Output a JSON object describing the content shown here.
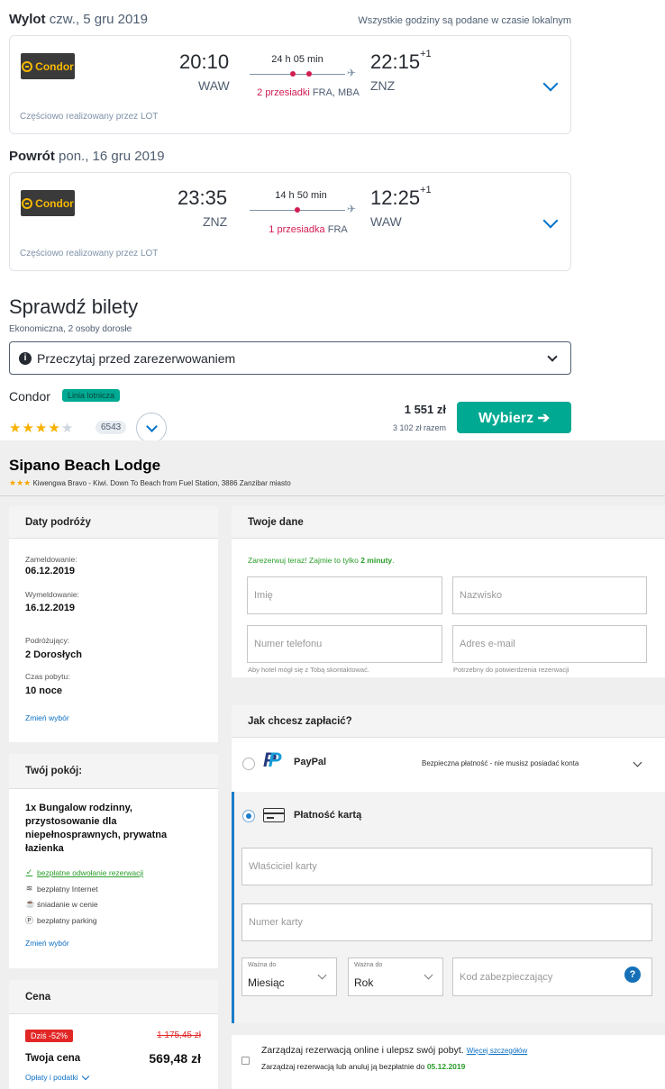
{
  "flights": {
    "timezone_note": "Wszystkie godziny są podane w czasie lokalnym",
    "outbound": {
      "label": "Wylot",
      "date": "czw., 5 gru 2019",
      "carrier": "Condor",
      "dep_time": "20:10",
      "dep_code": "WAW",
      "arr_time": "22:15",
      "arr_day_offset": "+1",
      "arr_code": "ZNZ",
      "duration": "24 h 05 min",
      "stops_label": "2 przesiadki",
      "stops_airports": "FRA, MBA",
      "operated_by": "Częściowo realizowany przez LOT"
    },
    "return": {
      "label": "Powrót",
      "date": "pon., 16 gru 2019",
      "carrier": "Condor",
      "dep_time": "23:35",
      "dep_code": "ZNZ",
      "arr_time": "12:25",
      "arr_day_offset": "+1",
      "arr_code": "WAW",
      "duration": "14 h 50 min",
      "stops_label": "1 przesiadka",
      "stops_airports": "FRA",
      "operated_by": "Częściowo realizowany przez LOT"
    }
  },
  "tickets": {
    "title": "Sprawdź bilety",
    "subtitle": "Ekonomiczna, 2 osoby dorosłe",
    "read_before": "Przeczytaj przed zarezerwowaniem",
    "carrier": "Condor",
    "carrier_badge": "Linia lotnicza",
    "rating_stars": 4,
    "rating_max": 5,
    "review_count": "6543",
    "price": "1 551 zł",
    "price_total": "3 102 zł razem",
    "choose_label": "Wybierz ➔"
  },
  "hotel": {
    "name": "Sipano Beach Lodge",
    "stars": "★★★",
    "address": "Kiwengwa Bravo - Kiwi. Down To Beach from Fuel Station, 3886 Zanzibar miasto",
    "trip": {
      "title": "Daty podróży",
      "checkin_label": "Zameldowanie:",
      "checkin": "06.12.2019",
      "checkout_label": "Wymeldowanie:",
      "checkout": "16.12.2019",
      "travelers_label": "Podróżujący:",
      "travelers": "2 Dorosłych",
      "stay_label": "Czas pobytu:",
      "stay": "10 noce",
      "change": "Zmień wybór"
    },
    "room": {
      "title": "Twój pokój:",
      "name": "1x Bungalow rodzinny, przystosowanie dla niepełnosprawnych, prywatna łazienka",
      "amenities": [
        "bezpłatne odwołanie rezerwacji",
        "bezpłatny Internet",
        "śniadanie w cenie",
        "bezpłatny parking"
      ],
      "change": "Zmień wybór"
    },
    "price": {
      "title": "Cena",
      "discount": "Dziś -52%",
      "old": "1 175,45 zł",
      "label": "Twoja cena",
      "value": "569,48 zł",
      "fees": "Opłaty i podatki"
    },
    "your_data": {
      "title": "Twoje dane",
      "note_prefix": "Zarezerwuj teraz! Zajmie to tylko ",
      "note_bold": "2 minuty",
      "note_suffix": ".",
      "first_name": "Imię",
      "last_name": "Nazwisko",
      "phone": "Numer telefonu",
      "email": "Adres e-mail",
      "phone_hint": "Aby hotel mógł się z Tobą skontaktować.",
      "email_hint": "Potrzebny do potwierdzenia rezerwacji"
    },
    "payment": {
      "title": "Jak chcesz zapłacić?",
      "paypal": "PayPal",
      "paypal_desc": "Bezpieczna płatność - nie musisz posiadać konta",
      "card": "Płatność kartą",
      "card_holder": "Właściciel karty",
      "card_number": "Numer karty",
      "valid_to": "Ważna do",
      "month": "Miesiąc",
      "year": "Rok",
      "cvv": "Kod zabezpieczający",
      "help": "?"
    },
    "manage": {
      "title": "Zarządzaj rezerwacją online i ulepsz swój pobyt.",
      "more": "Więcej szczegółów",
      "sub_prefix": "Zarządzaj rezerwacją lub anuluj ją bezpłatnie do ",
      "sub_date": "05.12.2019"
    }
  }
}
